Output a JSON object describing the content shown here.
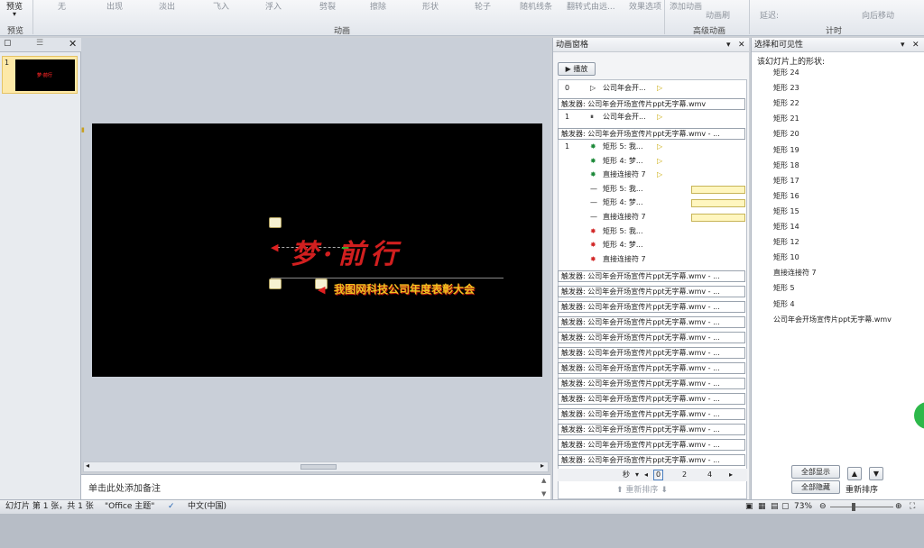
{
  "ribbon": {
    "preview_label": "预览",
    "preview_group": "预览",
    "effects": [
      "无",
      "出现",
      "淡出",
      "飞入",
      "浮入",
      "劈裂",
      "擦除",
      "形状",
      "轮子",
      "随机线条",
      "翻转式由远..."
    ],
    "effect_options": "效果选项",
    "animation_group": "动画",
    "add_animation": "添加动画",
    "animation_painter": "动画刷",
    "advanced_group": "高级动画",
    "delay_label": "延迟:",
    "move_later": "向后移动",
    "timing_group": "计时"
  },
  "slides_pane": {
    "slide_number": "1"
  },
  "slide": {
    "title_main": "梦·前行",
    "subtitle": "我图网科技公司年度表彰大会"
  },
  "notes": {
    "placeholder": "单击此处添加备注"
  },
  "animation_pane": {
    "title": "动画窗格",
    "play_label": "播放",
    "first_item": {
      "number": "0",
      "name": "公司年会开..."
    },
    "triggers_top": [
      {
        "label": "触发器: 公司年会开场宣传片ppt无字幕.wmv",
        "number": "1",
        "name": "公司年会开..."
      },
      {
        "label": "触发器: 公司年会开场宣传片ppt无字幕.wmv - ..."
      }
    ],
    "group_number": "1",
    "effects": [
      {
        "name": "矩形 5: 我...",
        "kind": "entrance"
      },
      {
        "name": "矩形 4: 梦...",
        "kind": "entrance"
      },
      {
        "name": "直接连接符 7",
        "kind": "entrance"
      },
      {
        "name": "矩形 5: 我...",
        "kind": "path"
      },
      {
        "name": "矩形 4: 梦...",
        "kind": "path"
      },
      {
        "name": "直接连接符 7",
        "kind": "path"
      },
      {
        "name": "矩形 5: 我...",
        "kind": "exit"
      },
      {
        "name": "矩形 4: 梦...",
        "kind": "exit"
      },
      {
        "name": "直接连接符 7",
        "kind": "exit"
      }
    ],
    "trigger_list_label": "触发器: 公司年会开场宣传片ppt无字幕.wmv - ...",
    "trigger_list_count": 13,
    "seconds_label": "秒",
    "ticks": [
      "0",
      "2",
      "4"
    ],
    "reorder_label": "重新排序"
  },
  "selection_pane": {
    "title": "选择和可见性",
    "subtitle": "该幻灯片上的形状:",
    "shapes": [
      {
        "name": "矩形 24",
        "visible": false
      },
      {
        "name": "矩形 23",
        "visible": false
      },
      {
        "name": "矩形 22",
        "visible": false
      },
      {
        "name": "矩形 21",
        "visible": false
      },
      {
        "name": "矩形 20",
        "visible": false
      },
      {
        "name": "矩形 19",
        "visible": false
      },
      {
        "name": "矩形 18",
        "visible": false
      },
      {
        "name": "矩形 17",
        "visible": false
      },
      {
        "name": "矩形 16",
        "visible": false
      },
      {
        "name": "矩形 15",
        "visible": false
      },
      {
        "name": "矩形 14",
        "visible": false
      },
      {
        "name": "矩形 12",
        "visible": false
      },
      {
        "name": "矩形 10",
        "visible": false
      },
      {
        "name": "直接连接符 7",
        "visible": true
      },
      {
        "name": "矩形 5",
        "visible": true
      },
      {
        "name": "矩形 4",
        "visible": true
      },
      {
        "name": "公司年会开场宣传片ppt无字幕.wmv",
        "visible": true
      }
    ],
    "show_all": "全部显示",
    "hide_all": "全部隐藏",
    "reorder": "重新排序"
  },
  "status": {
    "slide_info": "幻灯片 第 1 张，共 1 张",
    "theme": "\"Office 主题\"",
    "language": "中文(中国)",
    "zoom": "73%"
  },
  "colors": {
    "accent_red": "#d21f1f",
    "gold": "#f0c020",
    "slide_bg": "#000000"
  }
}
